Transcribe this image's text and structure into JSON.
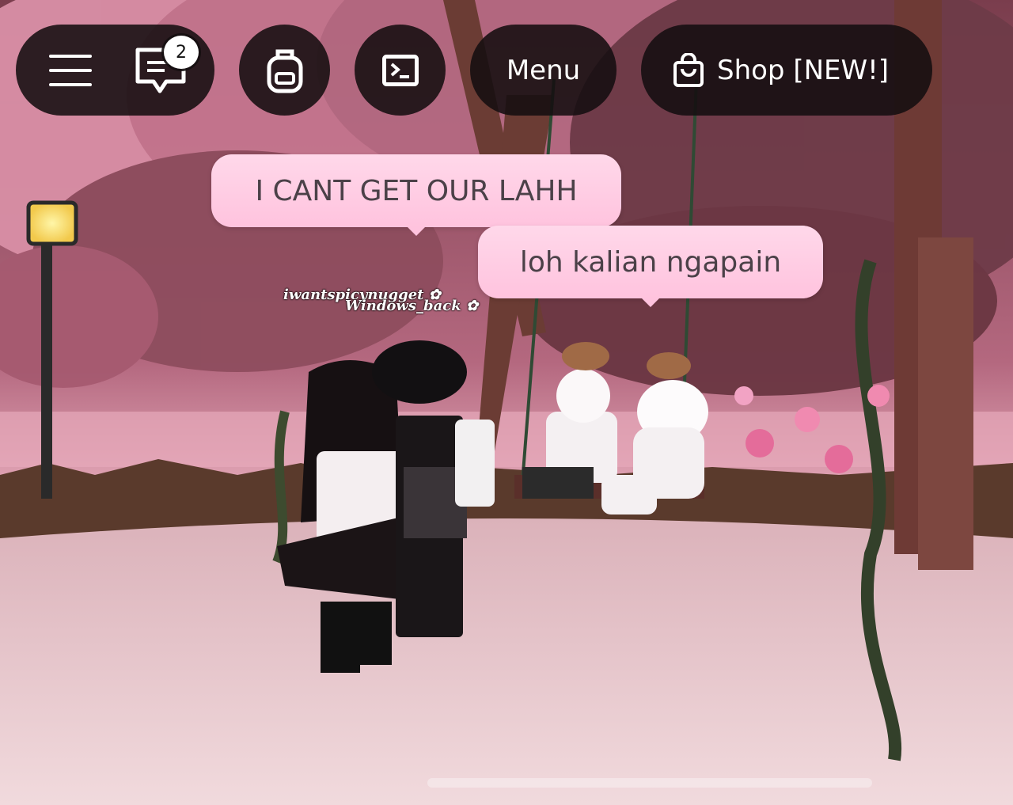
{
  "topbar": {
    "menu_icon": "hamburger-icon",
    "chat_icon": "chat-bubble-icon",
    "chat_badge": "2",
    "backpack_icon": "backpack-icon",
    "console_icon": "terminal-icon",
    "menu_label": "Menu",
    "shop_icon": "shopping-bag-icon",
    "shop_label": "Shop [NEW!]"
  },
  "chat_bubbles": [
    {
      "text": "I CANT GET OUR LAHH"
    },
    {
      "text": "loh kalian ngapain"
    }
  ],
  "player_tags": [
    {
      "name": "iwantspicynugget"
    },
    {
      "name": "Windows_back"
    }
  ],
  "colors": {
    "bar_bg": "#140e10",
    "bubble": "#ffc3de",
    "sky": "#c97c94",
    "ground": "#e9c9cd"
  }
}
